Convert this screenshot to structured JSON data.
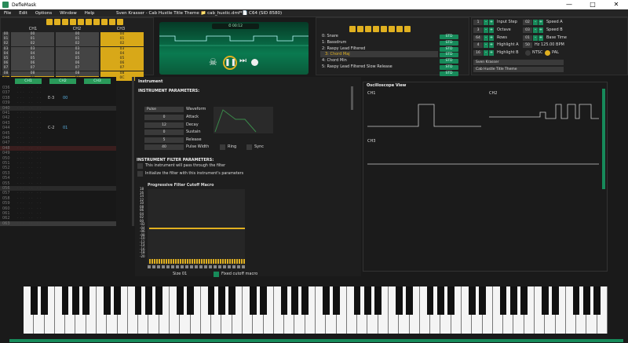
{
  "window": {
    "title": "DefleMask",
    "min_icon": "minimize-icon",
    "max_icon": "maximize-icon",
    "close_icon": "close-icon"
  },
  "menu": [
    "File",
    "Edit",
    "Options",
    "Window",
    "Help"
  ],
  "song_info": "Sven Krasser - Cab Hustle Title Theme 📁 cab_hustic.dmf*📄 C64 (SID 8580)",
  "orders": {
    "headers": [
      "CH1",
      "CH2",
      "CH3"
    ],
    "rows": [
      {
        "n": "00",
        "c": [
          "00",
          "00",
          "00"
        ]
      },
      {
        "n": "01",
        "c": [
          "01",
          "01",
          "01"
        ]
      },
      {
        "n": "02",
        "c": [
          "02",
          "02",
          "02"
        ]
      },
      {
        "n": "03",
        "c": [
          "03",
          "03",
          "03"
        ]
      },
      {
        "n": "04",
        "c": [
          "04",
          "04",
          "04"
        ]
      },
      {
        "n": "05",
        "c": [
          "05",
          "05",
          "05"
        ]
      },
      {
        "n": "06",
        "c": [
          "06",
          "06",
          "06"
        ]
      },
      {
        "n": "07",
        "c": [
          "07",
          "07",
          "07"
        ]
      },
      {
        "n": "08",
        "c": [
          "08",
          "08",
          "08"
        ]
      },
      {
        "n": "0C",
        "c": [
          "00",
          "01",
          "0C"
        ]
      }
    ]
  },
  "playback": {
    "time": "⏱ 00:12",
    "skull_icon": "skull-icon",
    "pause_icon": "pause-icon",
    "step_icon": "step-forward-icon",
    "record_icon": "record-icon"
  },
  "instruments": {
    "items": [
      "0: Snare",
      "1: Bassdrum",
      "2: Raspy Lead Filtered",
      "3: Chord Maj",
      "4: Chord Min",
      "5: Raspy Lead Filtered Slow Release"
    ],
    "selected": 3,
    "type_label": "STD"
  },
  "settings": {
    "left": [
      {
        "value": "1",
        "label": "Input Step"
      },
      {
        "value": "3",
        "label": "Octave"
      },
      {
        "value": "64",
        "label": "Rows"
      },
      {
        "value": "4",
        "label": "Highlight A"
      },
      {
        "value": "16",
        "label": "Highlight B"
      }
    ],
    "right": [
      {
        "value": "02",
        "label": "Speed A"
      },
      {
        "value": "03",
        "label": "Speed B"
      },
      {
        "value": "01",
        "label": "Base Time"
      },
      {
        "value": "50",
        "label": "Hz  125.00 BPM"
      }
    ],
    "ntsc": "NTSC",
    "pal": "PAL",
    "author": "Sven Krasser",
    "song_name": "Cab Hustle Title Theme"
  },
  "pattern": {
    "channels": [
      "CH1",
      "CH2",
      "CH3"
    ],
    "rows": [
      {
        "n": "036",
        "note": "",
        "ins": ""
      },
      {
        "n": "037",
        "note": "",
        "ins": ""
      },
      {
        "n": "038",
        "note": "E-3",
        "ins": "00"
      },
      {
        "n": "039",
        "note": "",
        "ins": ""
      },
      {
        "n": "040",
        "note": "",
        "ins": ""
      },
      {
        "n": "041",
        "note": "",
        "ins": ""
      },
      {
        "n": "042",
        "note": "",
        "ins": ""
      },
      {
        "n": "043",
        "note": "",
        "ins": ""
      },
      {
        "n": "044",
        "note": "C-2",
        "ins": "01"
      },
      {
        "n": "045",
        "note": "",
        "ins": ""
      },
      {
        "n": "046",
        "note": "",
        "ins": ""
      },
      {
        "n": "047",
        "note": "",
        "ins": ""
      },
      {
        "n": "048",
        "note": "",
        "ins": ""
      },
      {
        "n": "049",
        "note": "",
        "ins": ""
      },
      {
        "n": "050",
        "note": "",
        "ins": ""
      },
      {
        "n": "051",
        "note": "",
        "ins": ""
      },
      {
        "n": "052",
        "note": "",
        "ins": ""
      },
      {
        "n": "053",
        "note": "",
        "ins": ""
      },
      {
        "n": "054",
        "note": "",
        "ins": ""
      },
      {
        "n": "055",
        "note": "",
        "ins": ""
      },
      {
        "n": "056",
        "note": "",
        "ins": ""
      },
      {
        "n": "057",
        "note": "",
        "ins": ""
      },
      {
        "n": "058",
        "note": "",
        "ins": ""
      },
      {
        "n": "059",
        "note": "",
        "ins": ""
      },
      {
        "n": "060",
        "note": "",
        "ins": ""
      },
      {
        "n": "061",
        "note": "",
        "ins": ""
      },
      {
        "n": "062",
        "note": "",
        "ins": ""
      },
      {
        "n": "063",
        "note": "",
        "ins": ""
      }
    ]
  },
  "instrument_editor": {
    "window_title": "Instrument",
    "params_title": "INSTRUMENT PARAMETERS:",
    "waveform_value": "Pulse",
    "waveform_label": "Waveform",
    "params": [
      {
        "value": "0",
        "label": "Attack"
      },
      {
        "value": "12",
        "label": "Decay"
      },
      {
        "value": "0",
        "label": "Sustain"
      },
      {
        "value": "5",
        "label": "Release"
      },
      {
        "value": "40",
        "label": "Pulse Width"
      }
    ],
    "ring": "Ring",
    "sync": "Sync",
    "filter_title": "INSTRUMENT FILTER PARAMETERS:",
    "filter_opt1": "This instrument will pass through the filter",
    "filter_opt2": "Initialize the filter with this instrument's parameters",
    "macro_title": "Progressive Filter Cutoff Macro",
    "macro_ticks": [
      "18",
      "16",
      "14",
      "12",
      "10",
      "08",
      "06",
      "04",
      "02",
      "00",
      "-02",
      "-04",
      "-06",
      "-08",
      "-10",
      "-12",
      "-14",
      "-16",
      "-18",
      "-20"
    ],
    "macro_bottom": "Size 01",
    "fixed_label": "Fixed cutoff macro"
  },
  "oscilloscope": {
    "title": "Oscilloscope View",
    "ch1": "CH1",
    "ch2": "CH2",
    "ch3": "CH3"
  },
  "accent": "#e0b020",
  "green": "#178a5a"
}
